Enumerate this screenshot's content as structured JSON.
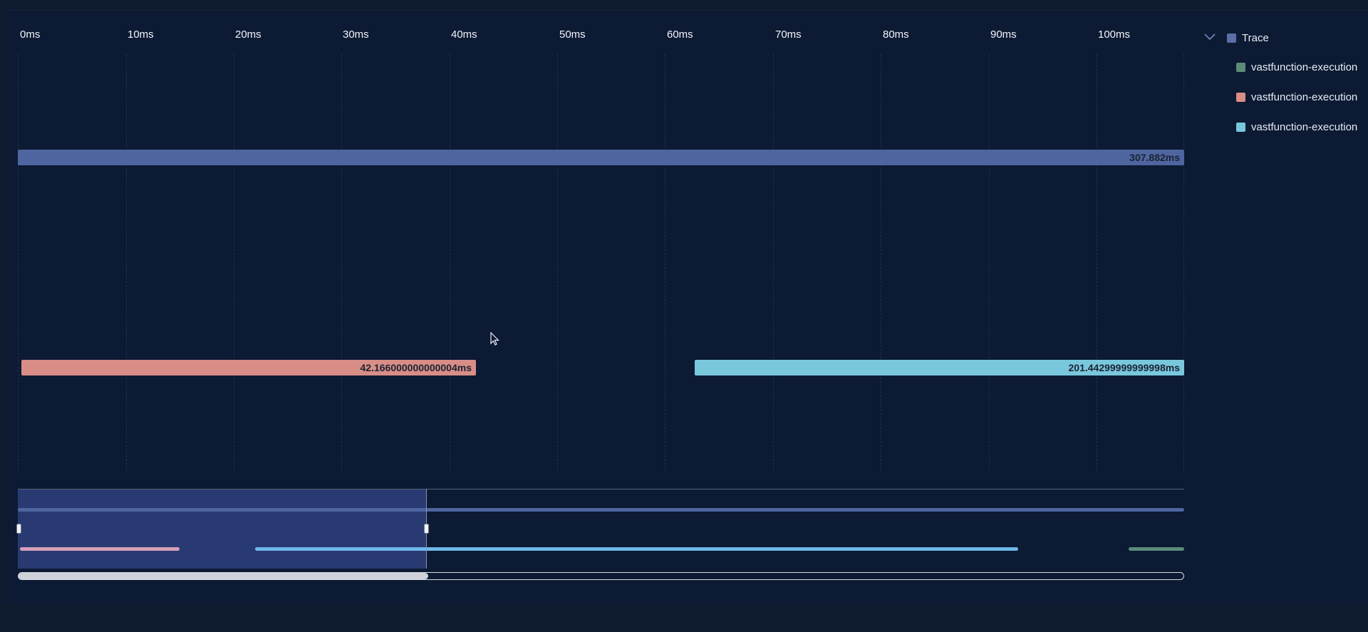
{
  "axis": {
    "ticks": [
      "0ms",
      "10ms",
      "20ms",
      "30ms",
      "40ms",
      "50ms",
      "60ms",
      "70ms",
      "80ms",
      "90ms",
      "100ms"
    ]
  },
  "spans": {
    "trace": {
      "label": "307.882ms",
      "color": "#4f65a0"
    },
    "execution_1": {
      "label": "42.166000000000004ms",
      "color": "#d88d86"
    },
    "execution_2": {
      "label": "201.44299999999998ms",
      "color": "#79c7dd"
    }
  },
  "legend": {
    "root": {
      "label": "Trace",
      "color": "#5b6fa8",
      "icon": "chevron-down-icon"
    },
    "items": [
      {
        "label": "vastfunction-execution",
        "color": "#5b8c7a"
      },
      {
        "label": "vastfunction-execution",
        "color": "#d88d86"
      },
      {
        "label": "vastfunction-execution",
        "color": "#79c7dd"
      }
    ]
  },
  "minimap": {
    "selection_color": "#293a72",
    "trace_line_color": "#4f65a0",
    "exec1_color": "#d6a0b8",
    "exec2_color": "#6fb7ea",
    "exec3_color": "#5b8c7a"
  },
  "colors": {
    "background": "#0c1a33",
    "gridline": "#1f3150"
  }
}
